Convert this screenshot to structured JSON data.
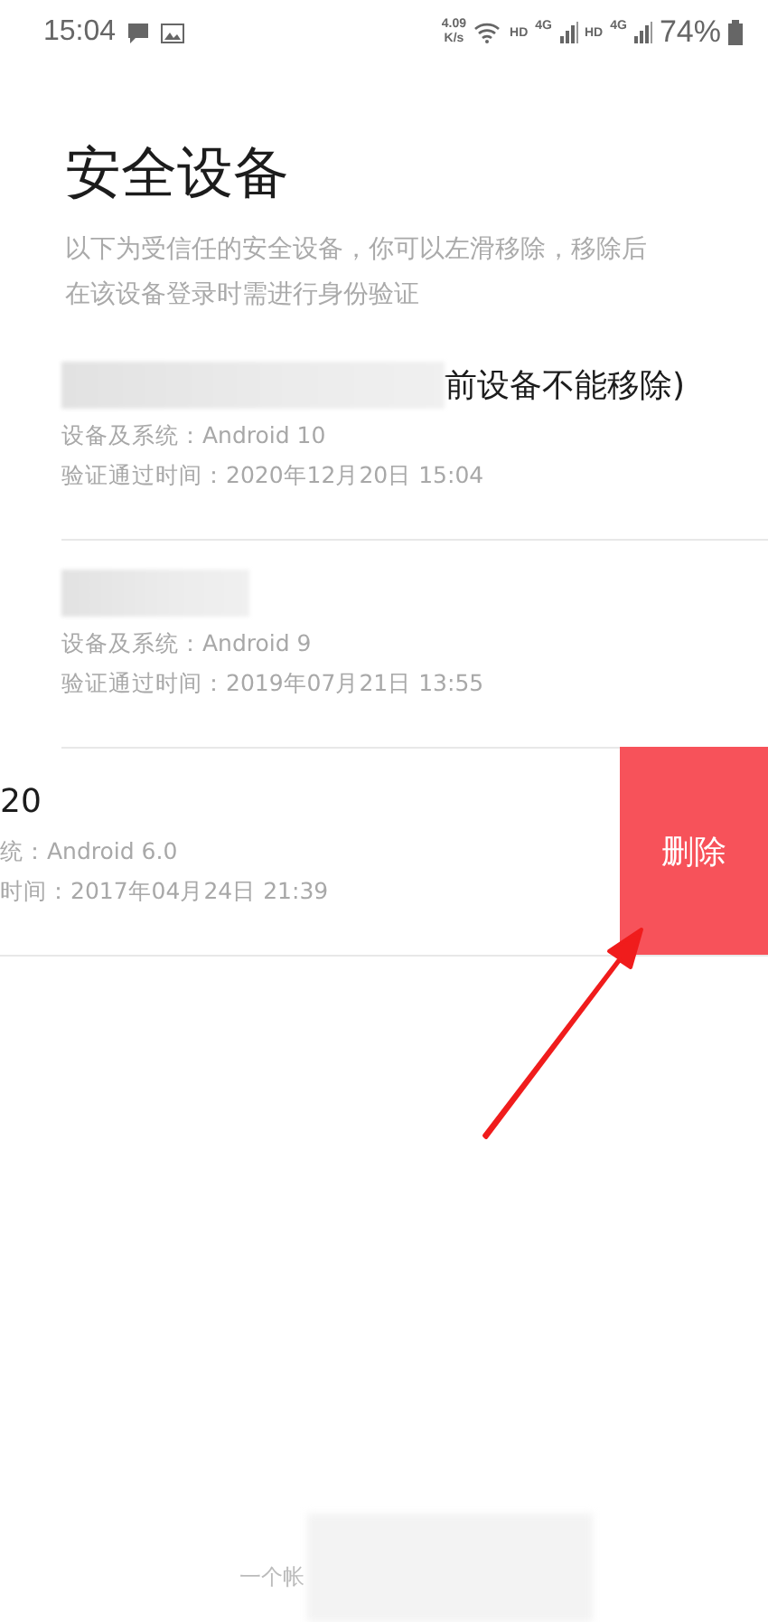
{
  "status_bar": {
    "time": "15:04",
    "speed": "4.09",
    "speed_unit": "K/s",
    "sims": [
      {
        "label": "HD",
        "network": "4G"
      },
      {
        "label": "HD",
        "network": "4G"
      }
    ],
    "battery": "74%"
  },
  "header": {
    "title": "安全设备",
    "description": "以下为受信任的安全设备，你可以左滑移除，移除后在该设备登录时需进行身份验证"
  },
  "devices": [
    {
      "name": "前设备不能移除)",
      "name_redacted": true,
      "system": "设备及系统：Android 10",
      "verified": "验证通过时间：2020年12月20日 15:04",
      "swiped": false
    },
    {
      "name_redacted": true,
      "system": "设备及系统：Android 9",
      "verified": "验证通过时间：2019年07月21日 13:55",
      "swiped": false
    },
    {
      "name": "20",
      "name_redacted": false,
      "system": "统：Android 6.0",
      "verified": "时间：2017年04月24日 21:39",
      "swiped": true,
      "action": "删除"
    }
  ],
  "footer": {
    "text": "一个帐",
    "redacted": true
  }
}
